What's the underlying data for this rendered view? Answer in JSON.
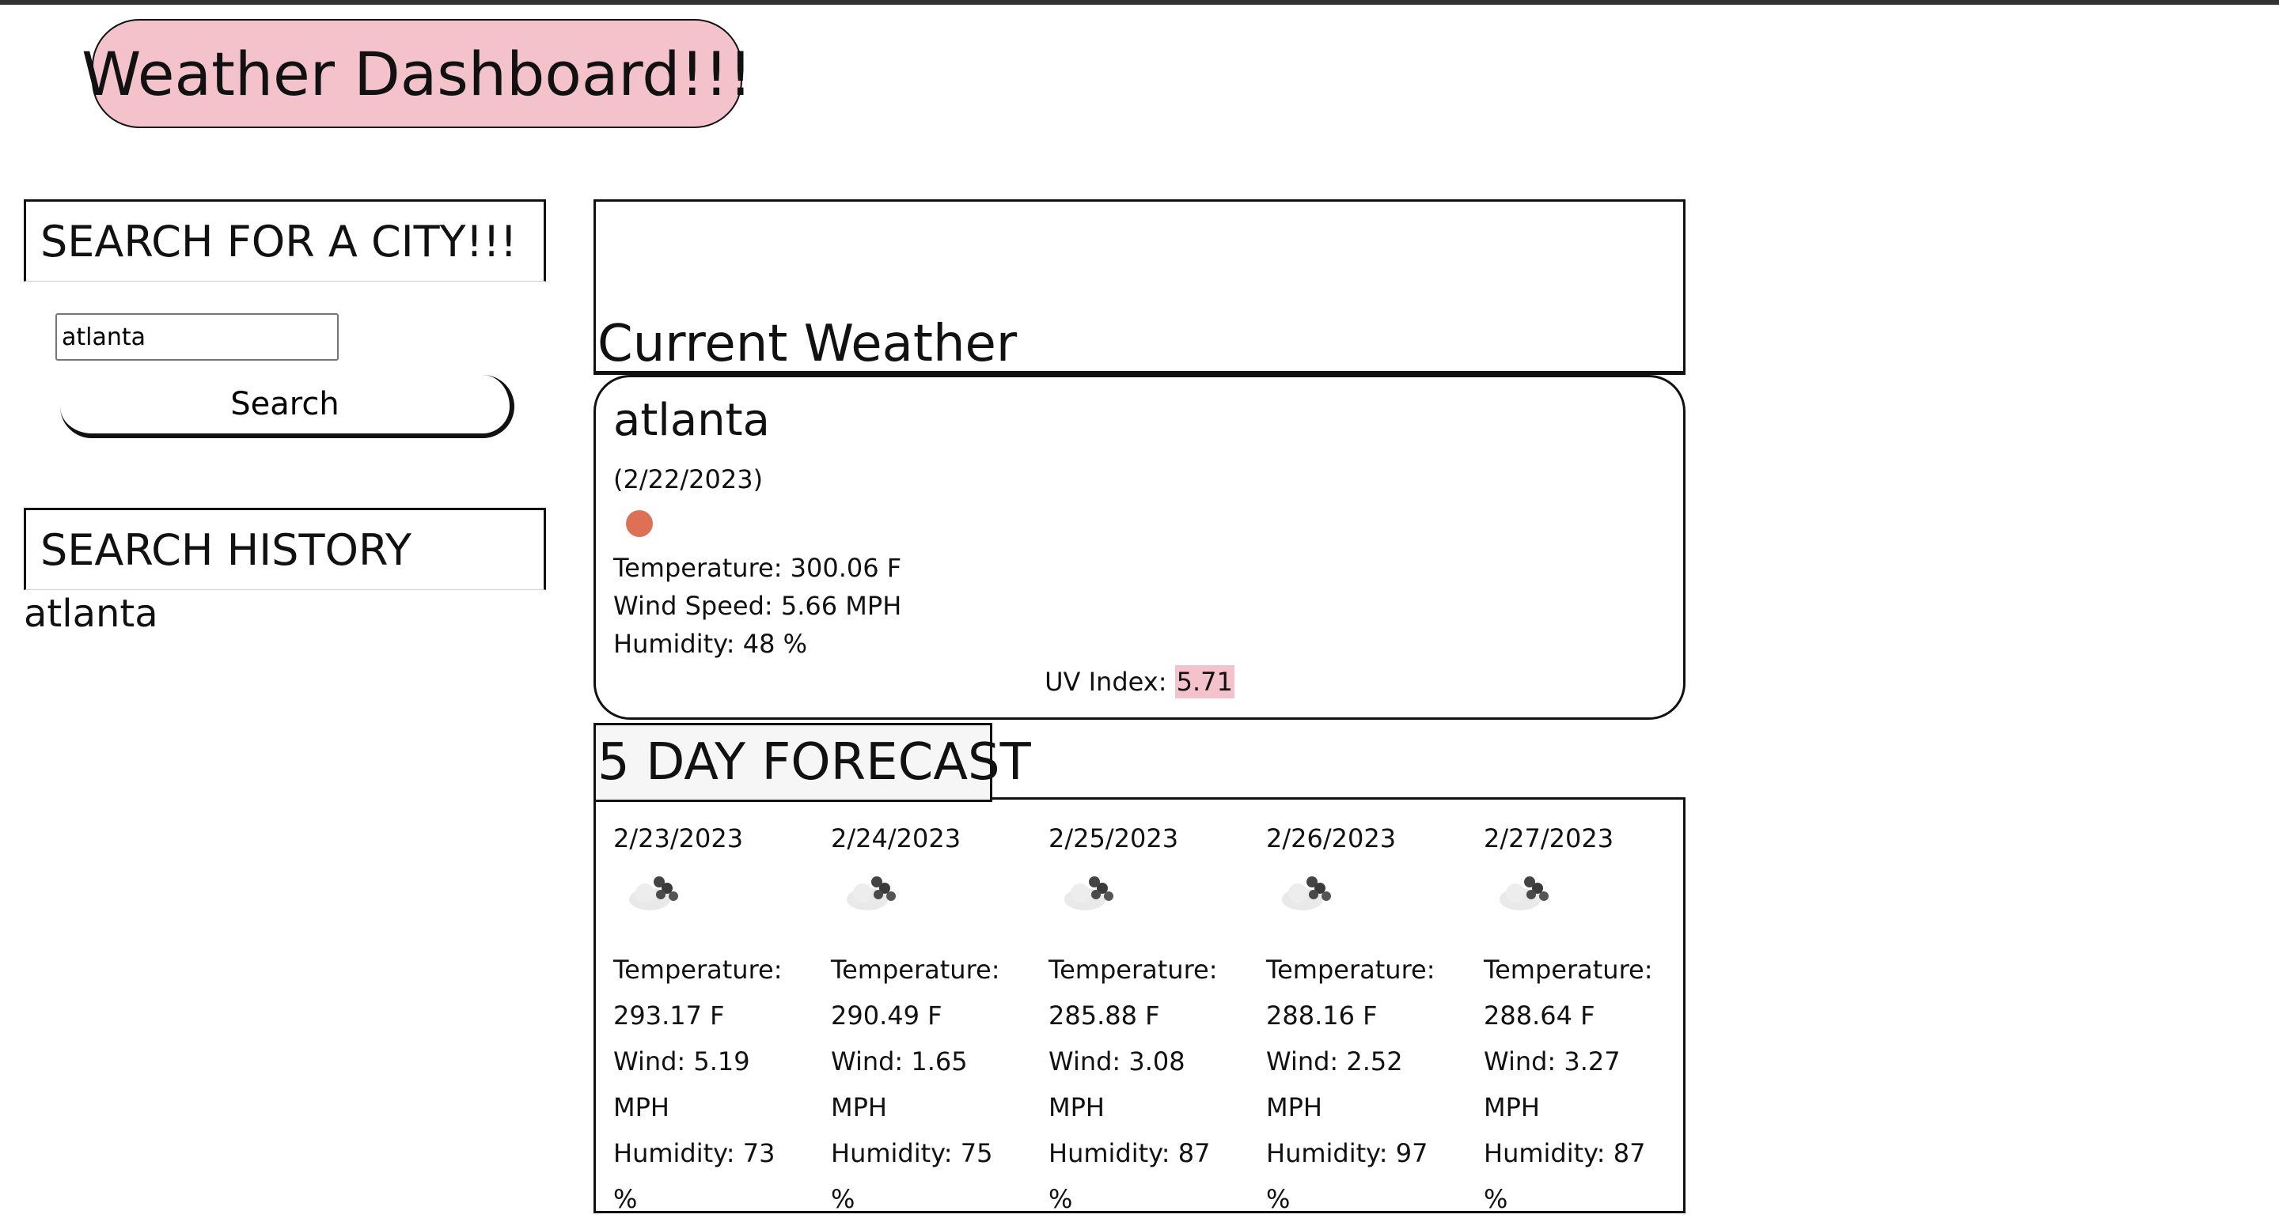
{
  "header": {
    "title": "Weather Dashboard!!!"
  },
  "search": {
    "heading": "SEARCH FOR A CITY!!!",
    "input_value": "atlanta",
    "button_label": "Search"
  },
  "history": {
    "heading": "SEARCH HISTORY",
    "items": [
      "atlanta"
    ]
  },
  "current": {
    "heading": "Current Weather",
    "city": "atlanta",
    "date": "(2/22/2023)",
    "icon": "sun-dot-icon",
    "temperature": "Temperature: 300.06 F",
    "wind": "Wind Speed: 5.66 MPH",
    "humidity": "Humidity: 48 %",
    "uv_label": "UV Index: ",
    "uv_value": "5.71",
    "uv_color": "#f4c2cb"
  },
  "forecast": {
    "heading": "5 DAY FORECAST",
    "days": [
      {
        "date": "2/23/2023",
        "icon": "cloudy-icon",
        "temp_label": "Temperature:",
        "temp": "293.17 F",
        "wind_label": "Wind: 5.19",
        "wind_unit": "MPH",
        "hum_label": "Humidity: 73",
        "hum_unit": "%"
      },
      {
        "date": "2/24/2023",
        "icon": "cloudy-icon",
        "temp_label": "Temperature:",
        "temp": "290.49 F",
        "wind_label": "Wind: 1.65",
        "wind_unit": "MPH",
        "hum_label": "Humidity: 75",
        "hum_unit": "%"
      },
      {
        "date": "2/25/2023",
        "icon": "cloudy-icon",
        "temp_label": "Temperature:",
        "temp": "285.88 F",
        "wind_label": "Wind: 3.08",
        "wind_unit": "MPH",
        "hum_label": "Humidity: 87",
        "hum_unit": "%"
      },
      {
        "date": "2/26/2023",
        "icon": "cloudy-icon",
        "temp_label": "Temperature:",
        "temp": "288.16 F",
        "wind_label": "Wind: 2.52",
        "wind_unit": "MPH",
        "hum_label": "Humidity: 97",
        "hum_unit": "%"
      },
      {
        "date": "2/27/2023",
        "icon": "cloudy-icon",
        "temp_label": "Temperature:",
        "temp": "288.64 F",
        "wind_label": "Wind: 3.27",
        "wind_unit": "MPH",
        "hum_label": "Humidity: 87",
        "hum_unit": "%"
      }
    ]
  },
  "colors": {
    "title_bg": "#f4c2cb",
    "sun_dot": "#de7055"
  }
}
